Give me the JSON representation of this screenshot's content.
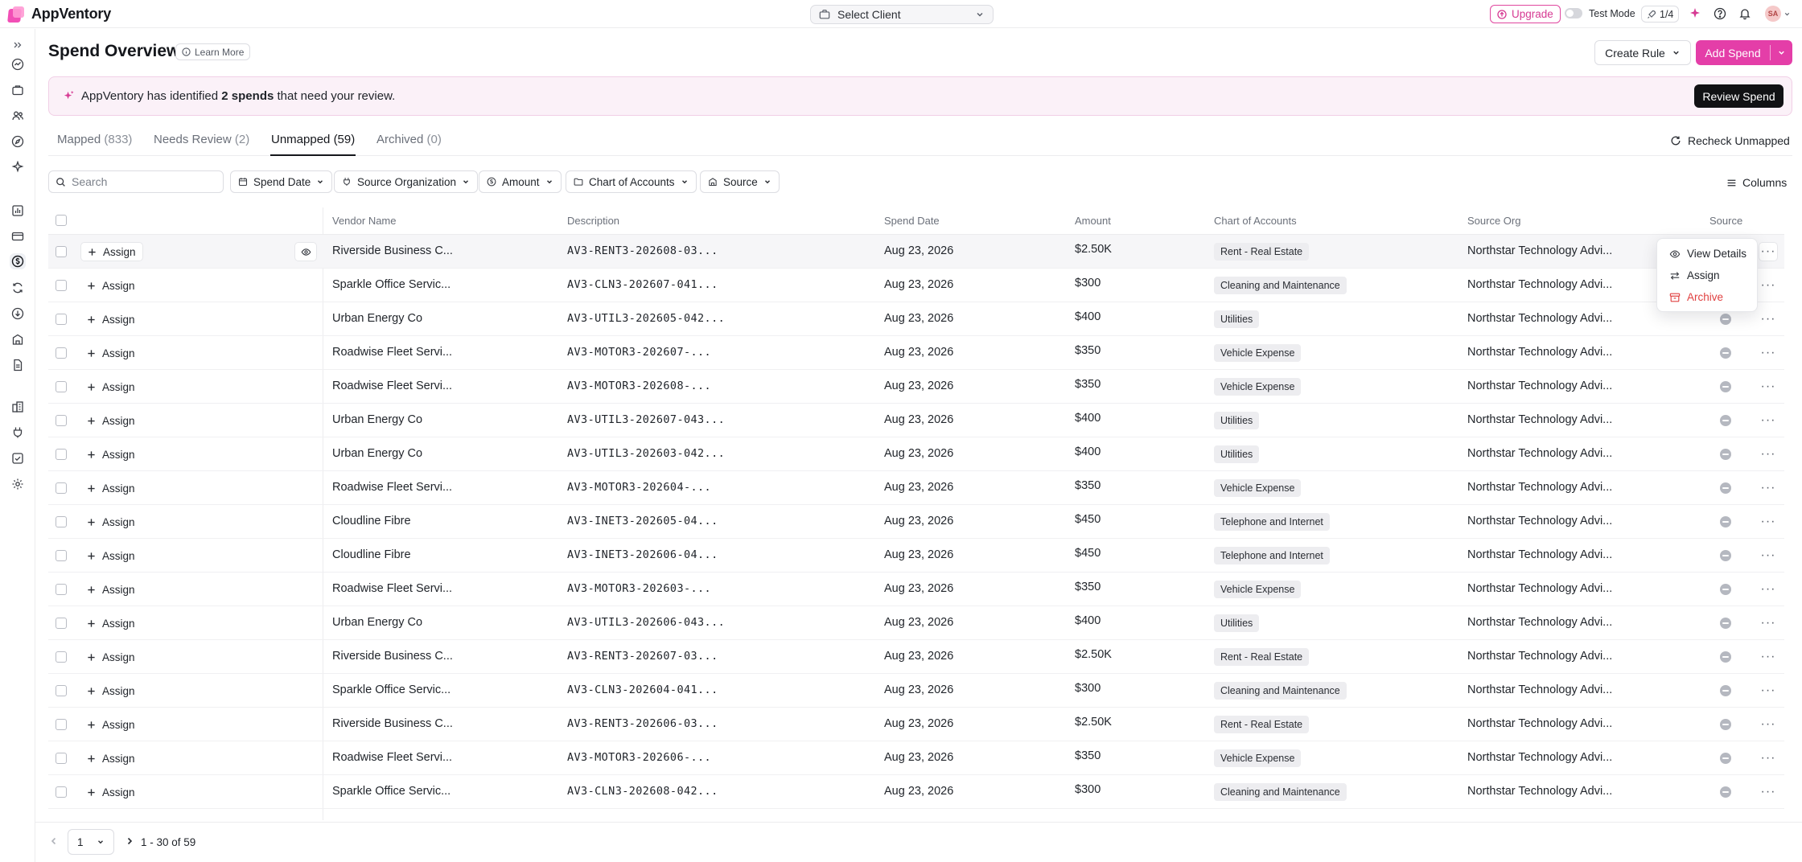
{
  "app": {
    "name": "AppVentory"
  },
  "topbar": {
    "client_select": "Select Client",
    "upgrade": "Upgrade",
    "test_mode": "Test Mode",
    "counter": "1/4",
    "avatar_initials": "SA"
  },
  "page": {
    "title": "Spend Overview",
    "learn_more": "Learn More",
    "create_rule": "Create Rule",
    "add_spend": "Add Spend"
  },
  "banner": {
    "prefix": "AppVentory has identified ",
    "highlight": "2 spends",
    "suffix": " that need your review.",
    "button": "Review Spend"
  },
  "tabs": [
    {
      "label": "Mapped",
      "count": "(833)"
    },
    {
      "label": "Needs Review",
      "count": "(2)"
    },
    {
      "label": "Unmapped",
      "count": "(59)"
    },
    {
      "label": "Archived",
      "count": "(0)"
    }
  ],
  "active_tab": "Unmapped",
  "recheck": "Recheck Unmapped",
  "filters": {
    "search_placeholder": "Search",
    "spend_date": "Spend Date",
    "source_org": "Source Organization",
    "amount": "Amount",
    "coa": "Chart of Accounts",
    "source": "Source",
    "columns": "Columns"
  },
  "table": {
    "headers": {
      "vendor": "Vendor Name",
      "description": "Description",
      "date": "Spend Date",
      "amount": "Amount",
      "coa": "Chart of Accounts",
      "org": "Source Org",
      "source": "Source"
    },
    "assign_label": "Assign",
    "rows": [
      {
        "vendor": "Riverside Business C...",
        "desc": "AV3-RENT3-202608-03...",
        "date": "Aug 23, 2026",
        "amount": "$2.50K",
        "coa": "Rent - Real Estate",
        "org": "Northstar Technology Advi..."
      },
      {
        "vendor": "Sparkle Office Servic...",
        "desc": "AV3-CLN3-202607-041...",
        "date": "Aug 23, 2026",
        "amount": "$300",
        "coa": "Cleaning and Maintenance",
        "org": "Northstar Technology Advi..."
      },
      {
        "vendor": "Urban Energy Co",
        "desc": "AV3-UTIL3-202605-042...",
        "date": "Aug 23, 2026",
        "amount": "$400",
        "coa": "Utilities",
        "org": "Northstar Technology Advi..."
      },
      {
        "vendor": "Roadwise Fleet Servi...",
        "desc": "AV3-MOTOR3-202607-...",
        "date": "Aug 23, 2026",
        "amount": "$350",
        "coa": "Vehicle Expense",
        "org": "Northstar Technology Advi..."
      },
      {
        "vendor": "Roadwise Fleet Servi...",
        "desc": "AV3-MOTOR3-202608-...",
        "date": "Aug 23, 2026",
        "amount": "$350",
        "coa": "Vehicle Expense",
        "org": "Northstar Technology Advi..."
      },
      {
        "vendor": "Urban Energy Co",
        "desc": "AV3-UTIL3-202607-043...",
        "date": "Aug 23, 2026",
        "amount": "$400",
        "coa": "Utilities",
        "org": "Northstar Technology Advi..."
      },
      {
        "vendor": "Urban Energy Co",
        "desc": "AV3-UTIL3-202603-042...",
        "date": "Aug 23, 2026",
        "amount": "$400",
        "coa": "Utilities",
        "org": "Northstar Technology Advi..."
      },
      {
        "vendor": "Roadwise Fleet Servi...",
        "desc": "AV3-MOTOR3-202604-...",
        "date": "Aug 23, 2026",
        "amount": "$350",
        "coa": "Vehicle Expense",
        "org": "Northstar Technology Advi..."
      },
      {
        "vendor": "Cloudline Fibre",
        "desc": "AV3-INET3-202605-04...",
        "date": "Aug 23, 2026",
        "amount": "$450",
        "coa": "Telephone and Internet",
        "org": "Northstar Technology Advi..."
      },
      {
        "vendor": "Cloudline Fibre",
        "desc": "AV3-INET3-202606-04...",
        "date": "Aug 23, 2026",
        "amount": "$450",
        "coa": "Telephone and Internet",
        "org": "Northstar Technology Advi..."
      },
      {
        "vendor": "Roadwise Fleet Servi...",
        "desc": "AV3-MOTOR3-202603-...",
        "date": "Aug 23, 2026",
        "amount": "$350",
        "coa": "Vehicle Expense",
        "org": "Northstar Technology Advi..."
      },
      {
        "vendor": "Urban Energy Co",
        "desc": "AV3-UTIL3-202606-043...",
        "date": "Aug 23, 2026",
        "amount": "$400",
        "coa": "Utilities",
        "org": "Northstar Technology Advi..."
      },
      {
        "vendor": "Riverside Business C...",
        "desc": "AV3-RENT3-202607-03...",
        "date": "Aug 23, 2026",
        "amount": "$2.50K",
        "coa": "Rent - Real Estate",
        "org": "Northstar Technology Advi..."
      },
      {
        "vendor": "Sparkle Office Servic...",
        "desc": "AV3-CLN3-202604-041...",
        "date": "Aug 23, 2026",
        "amount": "$300",
        "coa": "Cleaning and Maintenance",
        "org": "Northstar Technology Advi..."
      },
      {
        "vendor": "Riverside Business C...",
        "desc": "AV3-RENT3-202606-03...",
        "date": "Aug 23, 2026",
        "amount": "$2.50K",
        "coa": "Rent - Real Estate",
        "org": "Northstar Technology Advi..."
      },
      {
        "vendor": "Roadwise Fleet Servi...",
        "desc": "AV3-MOTOR3-202606-...",
        "date": "Aug 23, 2026",
        "amount": "$350",
        "coa": "Vehicle Expense",
        "org": "Northstar Technology Advi..."
      },
      {
        "vendor": "Sparkle Office Servic...",
        "desc": "AV3-CLN3-202608-042...",
        "date": "Aug 23, 2026",
        "amount": "$300",
        "coa": "Cleaning and Maintenance",
        "org": "Northstar Technology Advi..."
      }
    ]
  },
  "context_menu": {
    "view_details": "View Details",
    "assign": "Assign",
    "archive": "Archive"
  },
  "pagination": {
    "page": "1",
    "range": "1 - 30 of 59"
  },
  "colors": {
    "accent": "#e43ea8",
    "banner_bg": "#fbf1f8",
    "danger": "#e04040"
  }
}
